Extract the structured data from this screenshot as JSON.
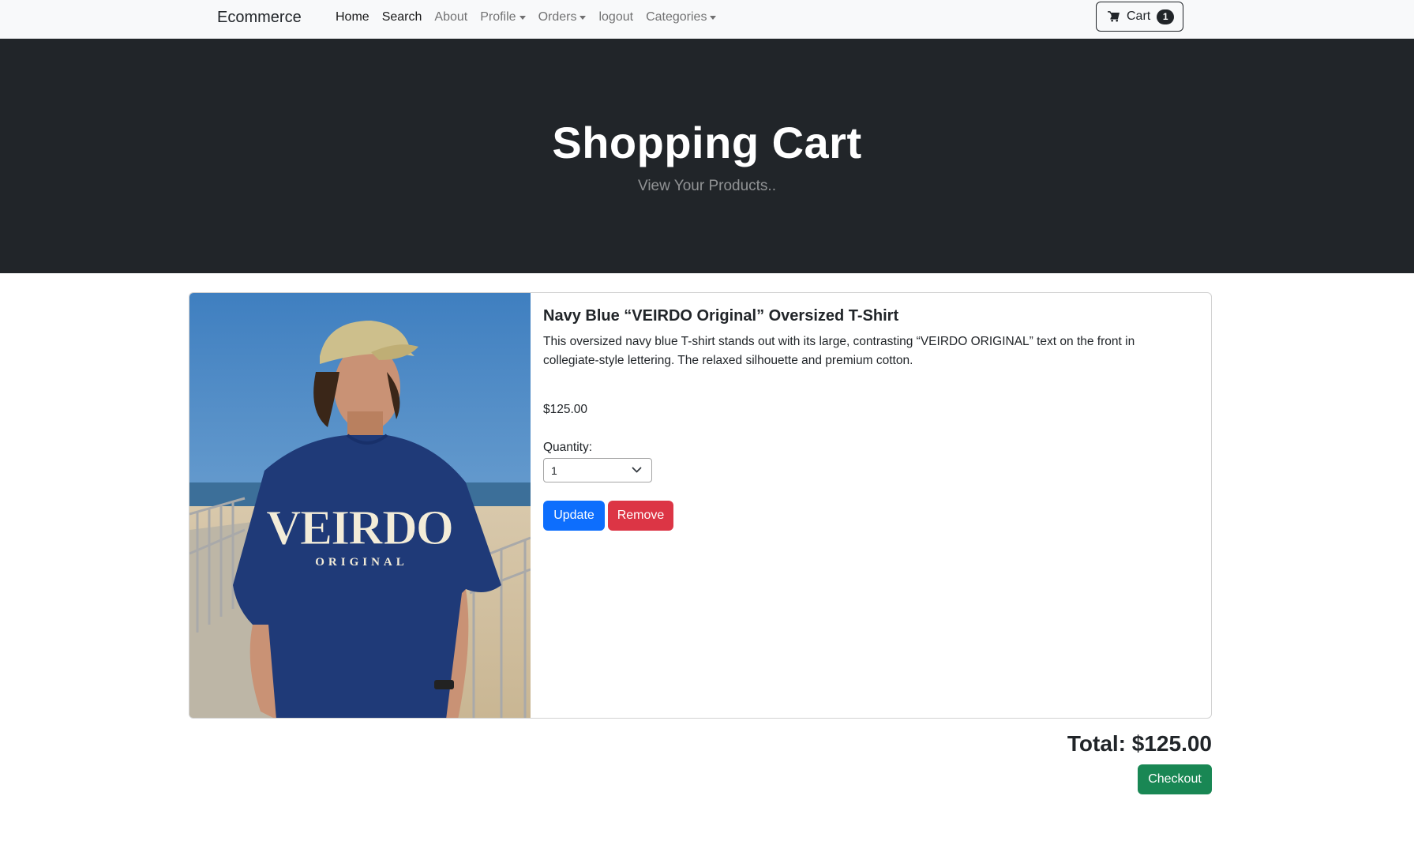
{
  "navbar": {
    "brand": "Ecommerce",
    "items": [
      {
        "label": "Home",
        "active": true,
        "dropdown": false
      },
      {
        "label": "Search",
        "active": true,
        "dropdown": false
      },
      {
        "label": "About",
        "active": false,
        "dropdown": false
      },
      {
        "label": "Profile",
        "active": false,
        "dropdown": true
      },
      {
        "label": "Orders",
        "active": false,
        "dropdown": true
      },
      {
        "label": "logout",
        "active": false,
        "dropdown": false
      },
      {
        "label": "Categories",
        "active": false,
        "dropdown": true
      }
    ],
    "cart": {
      "label": "Cart",
      "count": "1",
      "icon": "cart-icon"
    }
  },
  "header": {
    "title": "Shopping Cart",
    "subtitle": "View Your Products.."
  },
  "cart_item": {
    "image_alt": "Navy blue VEIRDO Original oversized t-shirt worn by model on a boardwalk",
    "title": "Navy Blue “VEIRDO Original” Oversized T-Shirt",
    "description": "This oversized navy blue T-shirt stands out with its large, contrasting “VEIRDO ORIGINAL” text on the front in collegiate-style lettering. The relaxed silhouette and premium cotton.",
    "price": "$125.00",
    "quantity_label": "Quantity:",
    "quantity_value": "1",
    "update_label": "Update",
    "remove_label": "Remove"
  },
  "summary": {
    "total": "Total: $125.00",
    "checkout_label": "Checkout"
  },
  "colors": {
    "primary": "#0d6efd",
    "danger": "#dc3545",
    "success": "#198754",
    "dark": "#212529",
    "navbar_bg": "#f8f9fa"
  }
}
